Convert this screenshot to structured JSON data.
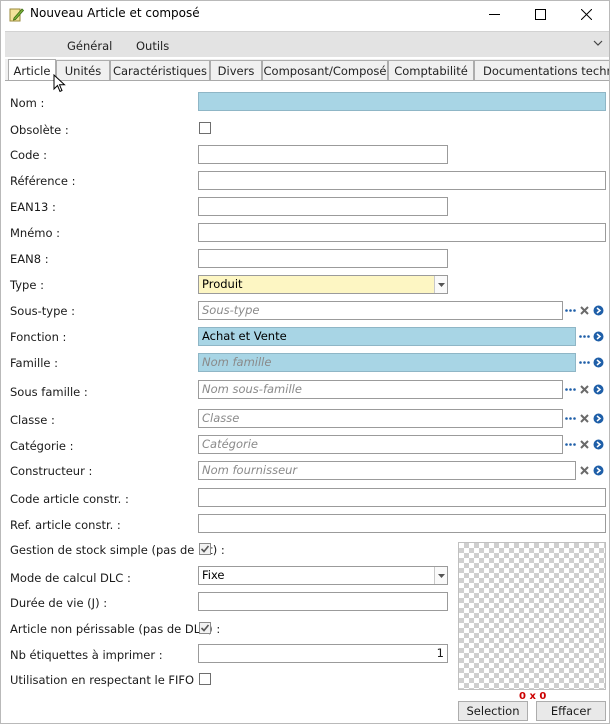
{
  "window": {
    "title": "Nouveau Article et composé",
    "controls": [
      "minimize-icon",
      "maximize-icon",
      "close-icon"
    ]
  },
  "menu": {
    "items": [
      "Général",
      "Outils"
    ]
  },
  "tabs": [
    {
      "label": "Article",
      "active": true
    },
    {
      "label": "Unités"
    },
    {
      "label": "Caractéristiques"
    },
    {
      "label": "Divers"
    },
    {
      "label": "Composant/Composé"
    },
    {
      "label": "Comptabilité"
    },
    {
      "label": "Documentations techniqu"
    }
  ],
  "form": {
    "nom": {
      "label": "Nom :",
      "value": ""
    },
    "obsolete": {
      "label": "Obsolète :",
      "checked": false
    },
    "code": {
      "label": "Code :",
      "value": ""
    },
    "reference": {
      "label": "Référence :",
      "value": ""
    },
    "ean13": {
      "label": "EAN13 :",
      "value": ""
    },
    "mnemo": {
      "label": "Mnémo :",
      "value": ""
    },
    "ean8": {
      "label": "EAN8 :",
      "value": ""
    },
    "type": {
      "label": "Type :",
      "value": "Produit"
    },
    "sous_type": {
      "label": "Sous-type :",
      "placeholder": "Sous-type"
    },
    "fonction": {
      "label": "Fonction :",
      "value": "Achat et Vente"
    },
    "famille": {
      "label": "Famille :",
      "placeholder": "Nom famille"
    },
    "sous_famille": {
      "label": "Sous famille :",
      "placeholder": "Nom sous-famille"
    },
    "classe": {
      "label": "Classe :",
      "placeholder": "Classe"
    },
    "categorie": {
      "label": "Catégorie :",
      "placeholder": "Catégorie"
    },
    "constructeur": {
      "label": "Constructeur :",
      "placeholder": "Nom fournisseur"
    },
    "code_article_constr": {
      "label": "Code article constr. :",
      "value": ""
    },
    "ref_article_constr": {
      "label": "Ref. article constr. :",
      "value": ""
    },
    "gestion_stock": {
      "label": "Gestion de stock simple (pas de lot) :",
      "checked": true
    },
    "mode_dlc": {
      "label": "Mode de calcul DLC :",
      "value": "Fixe"
    },
    "duree_vie": {
      "label": "Durée de vie (J) :",
      "value": ""
    },
    "non_perissable": {
      "label": "Article non périssable (pas de DLC) :",
      "checked": true
    },
    "nb_etiquettes": {
      "label": "Nb étiquettes à imprimer :",
      "value": "1"
    },
    "fifo": {
      "label": "Utilisation en respectant le FIFO :",
      "checked": false
    }
  },
  "image": {
    "dimensions": "0 x 0"
  },
  "buttons": {
    "selection": "Selection",
    "effacer": "Effacer"
  },
  "colors": {
    "highlight_field": "#a8d5e5",
    "combo_yellow": "#fdf6c3",
    "accent_blue": "#1f5fa8",
    "dims_red": "#cc0000"
  }
}
